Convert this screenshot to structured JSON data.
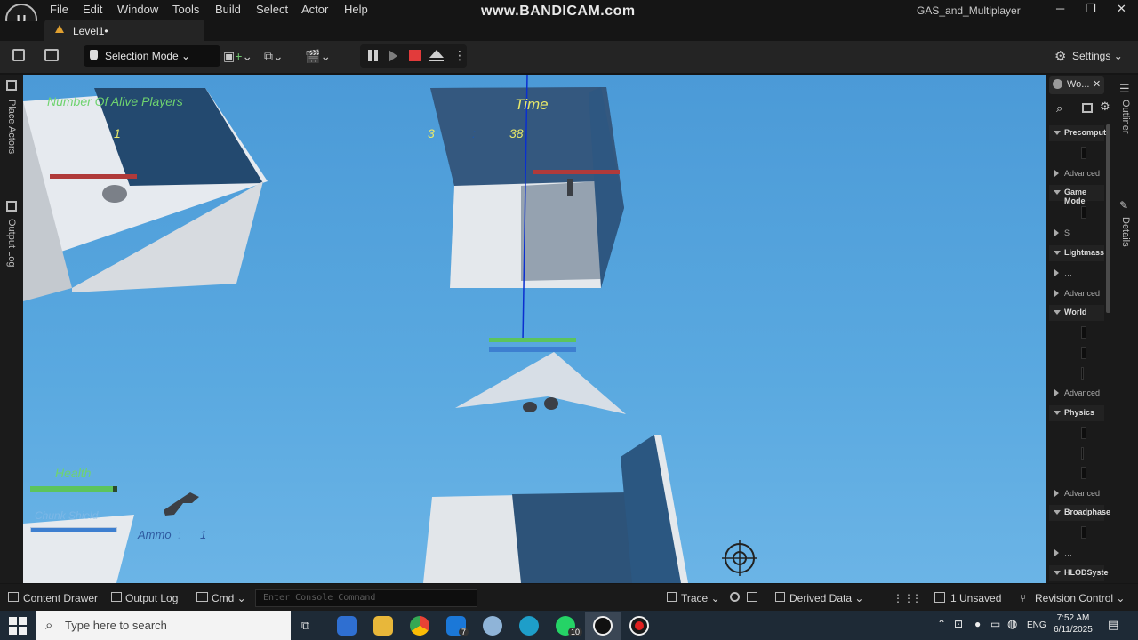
{
  "app": {
    "project_name": "GAS_and_Multiplayer",
    "logo_text": "U",
    "watermark": "www.BANDICAM.com"
  },
  "menu": [
    "File",
    "Edit",
    "Window",
    "Tools",
    "Build",
    "Select",
    "Actor",
    "Help"
  ],
  "tabs": {
    "level": "Level1•"
  },
  "toolbar": {
    "selection_mode": "Selection Mode",
    "settings": "Settings"
  },
  "left_panel": {
    "place_actors": "Place Actors",
    "output_log": "Output Log"
  },
  "hud": {
    "alive_players_label": "Number Of Alive Players",
    "alive_players_value": "1",
    "time_label": "Time",
    "time_minutes": "3",
    "time_sep": ":",
    "time_seconds": "38",
    "health_label": "Health",
    "health_fraction": 0.95,
    "shield_label": "Chunk Shield",
    "ammo_label": "Ammo",
    "ammo_sep": ":",
    "ammo_value": "1"
  },
  "outliner": {
    "world_tab": "Wo...",
    "outliner_label": "Outliner",
    "details_label": "Details",
    "sections": [
      "Precomput",
      "Game Mode",
      "Lightmass",
      "World",
      "Physics",
      "Broadphase",
      "HLODSyste"
    ],
    "advanced": "Advanced",
    "s_label": "S"
  },
  "statusbar": {
    "content_drawer": "Content Drawer",
    "output_log": "Output Log",
    "cmd": "Cmd",
    "console_placeholder": "Enter Console Command",
    "trace": "Trace",
    "derived_data": "Derived Data",
    "unsaved": "1 Unsaved",
    "revision_control": "Revision Control"
  },
  "taskbar": {
    "search_placeholder": "Type here to search",
    "mail_badge": "7",
    "whatsapp_badge": "10",
    "lang": "ENG",
    "time": "7:52 AM",
    "date": "6/11/2025"
  },
  "colors": {
    "ue_accent": "#e0a030",
    "sky": "#5aa9e0",
    "hud_green": "#6fd36f",
    "hud_yellow": "#e8e86a",
    "enemy_bar": "#b03a3a",
    "record_red": "#e02020"
  }
}
